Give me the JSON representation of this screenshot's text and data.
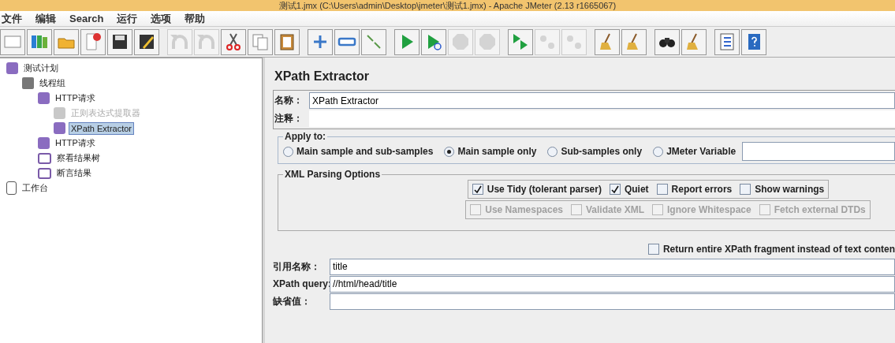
{
  "window": {
    "title": "测试1.jmx (C:\\Users\\admin\\Desktop\\jmeter\\测试1.jmx) - Apache JMeter (2.13 r1665067)"
  },
  "menu": [
    "文件",
    "编辑",
    "Search",
    "运行",
    "选项",
    "帮助"
  ],
  "toolbar": [
    [
      {
        "kind": "new",
        "disabled": false
      },
      {
        "kind": "templates",
        "disabled": false
      },
      {
        "kind": "open",
        "disabled": false
      },
      {
        "kind": "close",
        "disabled": false
      },
      {
        "kind": "save",
        "disabled": false
      },
      {
        "kind": "save-as",
        "disabled": false
      }
    ],
    [
      {
        "kind": "undo",
        "disabled": true
      },
      {
        "kind": "redo",
        "disabled": true
      },
      {
        "kind": "cut",
        "disabled": false
      },
      {
        "kind": "copy",
        "disabled": false
      },
      {
        "kind": "paste",
        "disabled": false
      }
    ],
    [
      {
        "kind": "expand",
        "disabled": false
      },
      {
        "kind": "collapse",
        "disabled": false
      },
      {
        "kind": "toggle",
        "disabled": false
      }
    ],
    [
      {
        "kind": "start",
        "disabled": false
      },
      {
        "kind": "start-no-timers",
        "disabled": false
      },
      {
        "kind": "stop",
        "disabled": true
      },
      {
        "kind": "shutdown",
        "disabled": true
      }
    ],
    [
      {
        "kind": "remote-start",
        "disabled": false
      },
      {
        "kind": "remote-stop",
        "disabled": true
      },
      {
        "kind": "remote-shutdown",
        "disabled": true
      }
    ],
    [
      {
        "kind": "clear",
        "disabled": false
      },
      {
        "kind": "clear-all",
        "disabled": false
      }
    ],
    [
      {
        "kind": "search",
        "disabled": false
      },
      {
        "kind": "reset-search",
        "disabled": false
      }
    ],
    [
      {
        "kind": "function-helper",
        "disabled": false
      },
      {
        "kind": "help",
        "disabled": false
      }
    ]
  ],
  "tree": [
    {
      "label": "测试计划",
      "kind": "plan",
      "enabled": true,
      "selected": false,
      "children": [
        {
          "label": "线程组",
          "kind": "threads",
          "enabled": true,
          "selected": false,
          "children": [
            {
              "label": "HTTP请求",
              "kind": "sampler",
              "enabled": true,
              "selected": false,
              "children": [
                {
                  "label": "正则表达式提取器",
                  "kind": "extractor",
                  "enabled": false,
                  "selected": false
                },
                {
                  "label": "XPath Extractor",
                  "kind": "xpath",
                  "enabled": true,
                  "selected": true
                }
              ]
            },
            {
              "label": "HTTP请求",
              "kind": "sampler",
              "enabled": true,
              "selected": false
            },
            {
              "label": "察看结果树",
              "kind": "listener",
              "enabled": true,
              "selected": false
            },
            {
              "label": "断言结果",
              "kind": "listener",
              "enabled": true,
              "selected": false
            }
          ]
        }
      ]
    },
    {
      "label": "工作台",
      "kind": "workbench",
      "enabled": true,
      "selected": false
    }
  ],
  "panel": {
    "title": "XPath Extractor",
    "name": {
      "label": "名称：",
      "value": "XPath Extractor"
    },
    "comments": {
      "label": "注释："
    },
    "apply_to": {
      "title": "Apply to:",
      "options": [
        {
          "label": "Main sample and sub-samples",
          "selected": false
        },
        {
          "label": "Main sample only",
          "selected": true
        },
        {
          "label": "Sub-samples only",
          "selected": false
        },
        {
          "label": "JMeter Variable",
          "selected": false
        }
      ]
    },
    "xml_parsing": {
      "title": "XML Parsing Options",
      "tidy_options": [
        {
          "label": "Use Tidy (tolerant parser)",
          "checked": true,
          "disabled": false
        },
        {
          "label": "Quiet",
          "checked": true,
          "disabled": false
        },
        {
          "label": "Report errors",
          "checked": false,
          "disabled": false
        },
        {
          "label": "Show warnings",
          "checked": false,
          "disabled": false
        }
      ],
      "parser_options": [
        {
          "label": "Use Namespaces",
          "checked": false,
          "disabled": true
        },
        {
          "label": "Validate XML",
          "checked": false,
          "disabled": true
        },
        {
          "label": "Ignore Whitespace",
          "checked": false,
          "disabled": true
        },
        {
          "label": "Fetch external DTDs",
          "checked": false,
          "disabled": true
        }
      ]
    },
    "return_fragment": {
      "label": "Return entire XPath fragment instead of text conten",
      "checked": false
    },
    "fields": [
      {
        "label": "引用名称：",
        "value": "title"
      },
      {
        "label": "XPath query:",
        "value": "//html/head/title"
      },
      {
        "label": "缺省值："
      }
    ]
  }
}
